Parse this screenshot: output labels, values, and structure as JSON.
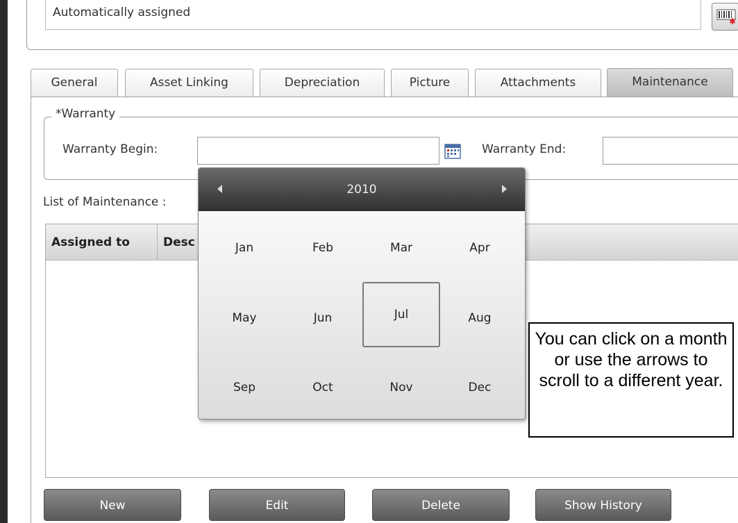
{
  "asset_id_field": {
    "value": "Automatically assigned"
  },
  "tabs": [
    {
      "label": "General",
      "active": false
    },
    {
      "label": "Asset Linking",
      "active": false
    },
    {
      "label": "Depreciation",
      "active": false
    },
    {
      "label": "Picture",
      "active": false
    },
    {
      "label": "Attachments",
      "active": false
    },
    {
      "label": "Maintenance",
      "active": true
    }
  ],
  "warranty": {
    "legend": "*Warranty",
    "begin_label": "Warranty Begin:",
    "begin_value": "",
    "end_label": "Warranty End:",
    "end_value": "",
    "calendar_icon": "calendar-icon"
  },
  "maintenance": {
    "list_label": "List of Maintenance",
    "list_label_visible": "List of Maintenance :",
    "columns": [
      "Assigned to",
      "Desc"
    ]
  },
  "calendar_popup": {
    "year": "2010",
    "prev_icon": "triangle-left-icon",
    "next_icon": "triangle-right-icon",
    "months": [
      "Jan",
      "Feb",
      "Mar",
      "Apr",
      "May",
      "Jun",
      "Jul",
      "Aug",
      "Sep",
      "Oct",
      "Nov",
      "Dec"
    ],
    "selected_month": "Jul"
  },
  "callout": {
    "text": "You can click on a month or use the arrows to scroll to a different year."
  },
  "buttons": {
    "new": "New",
    "edit": "Edit",
    "delete": "Delete",
    "show_history": "Show History"
  },
  "colors": {
    "button_fill": "#6f6f6f",
    "popup_header": "#444444",
    "active_tab": "#c9c9c9"
  }
}
